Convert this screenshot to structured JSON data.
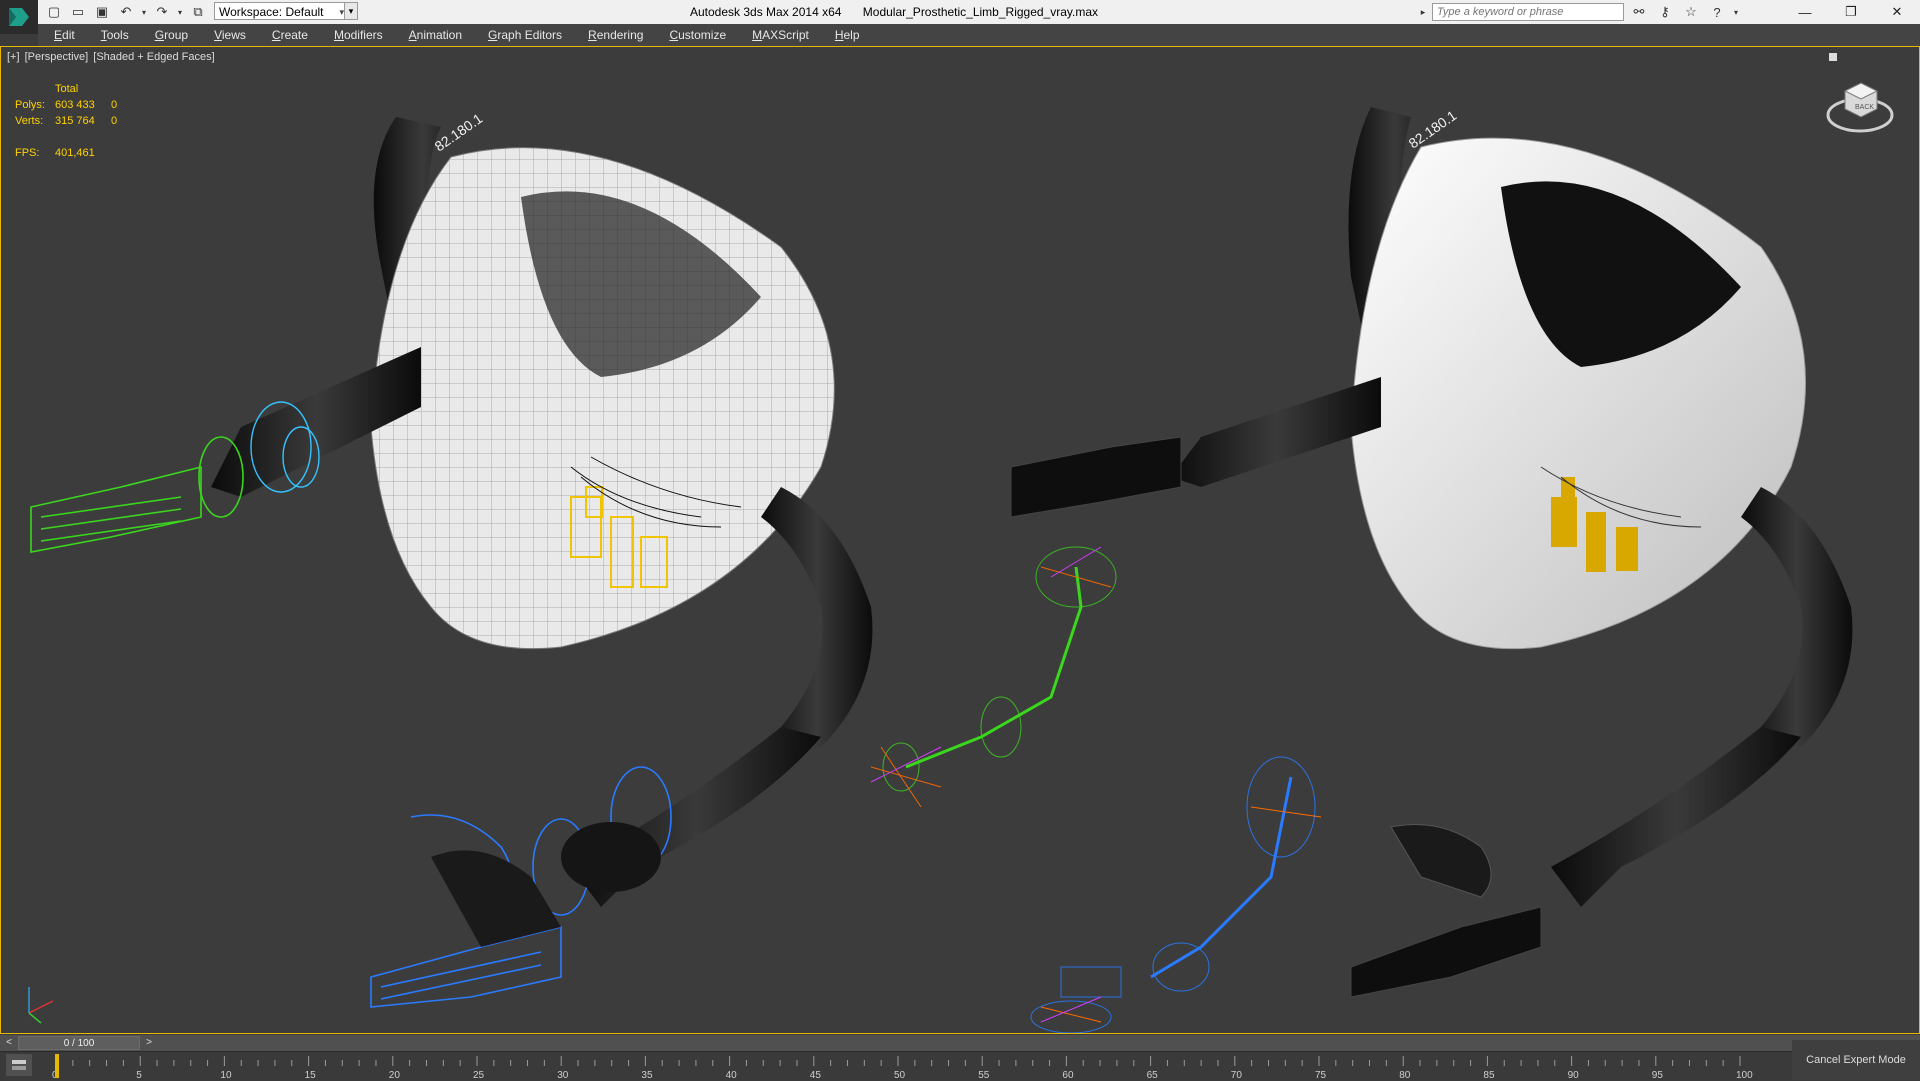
{
  "titlebar": {
    "app_title": "Autodesk 3ds Max  2014 x64",
    "file_name": "Modular_Prosthetic_Limb_Rigged_vray.max",
    "workspace_label": "Workspace: Default",
    "search_placeholder": "Type a keyword or phrase",
    "quick_access_icons": [
      "new-file-icon",
      "open-icon",
      "save-icon",
      "undo-icon",
      "redo-icon",
      "project-folder-icon"
    ],
    "infocenter_icons": [
      "binoculars-icon",
      "key-icon",
      "favorites-star-icon",
      "help-icon"
    ],
    "window_controls": [
      "minimize-icon",
      "restore-icon",
      "close-icon"
    ]
  },
  "menu": [
    "Edit",
    "Tools",
    "Group",
    "Views",
    "Create",
    "Modifiers",
    "Animation",
    "Graph Editors",
    "Rendering",
    "Customize",
    "MAXScript",
    "Help"
  ],
  "viewport": {
    "label_plus": "[+]",
    "label_view": "[Perspective]",
    "label_shading": "[Shaded + Edged Faces]",
    "stats": {
      "header": "Total",
      "polys_label": "Polys:",
      "polys_total": "603 433",
      "polys_sel": "0",
      "verts_label": "Verts:",
      "verts_total": "315 764",
      "verts_sel": "0",
      "fps_label": "FPS:",
      "fps_value": "401,461"
    },
    "decal_text": "82.180.1",
    "viewcube_label": "BACK"
  },
  "timeline": {
    "frame_display": "0 / 100",
    "prev": "<",
    "next": ">",
    "ticks": [
      "0",
      "5",
      "10",
      "15",
      "20",
      "25",
      "30",
      "35",
      "40",
      "45",
      "50",
      "55",
      "60",
      "65",
      "70",
      "75",
      "80",
      "85",
      "90",
      "95",
      "100"
    ],
    "cancel_expert": "Cancel Expert Mode"
  },
  "colors": {
    "accent_yellow": "#ffd200",
    "viewport_bg": "#3c3c3c",
    "rig_green": "#3bd61e",
    "rig_blue": "#2a7bff"
  }
}
